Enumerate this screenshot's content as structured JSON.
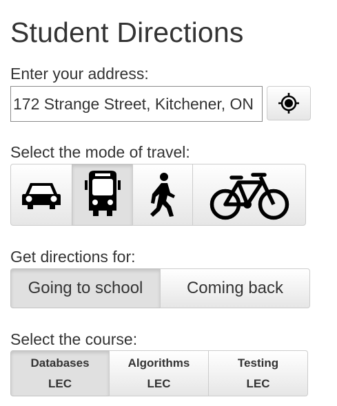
{
  "page": {
    "title": "Student Directions"
  },
  "address": {
    "label": "Enter your address:",
    "value": "172 Strange Street, Kitchener, ON",
    "locate_icon": "crosshair-locate-icon"
  },
  "travel": {
    "label": "Select the mode of travel:",
    "modes": [
      {
        "name": "car",
        "icon": "car-icon",
        "active": false
      },
      {
        "name": "bus",
        "icon": "bus-icon",
        "active": true
      },
      {
        "name": "walk",
        "icon": "walking-icon",
        "active": false
      },
      {
        "name": "bike",
        "icon": "bicycle-icon",
        "active": false
      }
    ]
  },
  "directions": {
    "label": "Get directions for:",
    "options": [
      {
        "label": "Going to school",
        "active": true
      },
      {
        "label": "Coming back",
        "active": false
      }
    ]
  },
  "course": {
    "label": "Select the course:",
    "options": [
      {
        "name": "Databases",
        "type": "LEC",
        "active": true
      },
      {
        "name": "Algorithms",
        "type": "LEC",
        "active": false
      },
      {
        "name": "Testing",
        "type": "LEC",
        "active": false
      }
    ]
  },
  "colors": {
    "text": "#333333",
    "button_border": "#cccccc",
    "button_active": "#e0e0e0"
  }
}
